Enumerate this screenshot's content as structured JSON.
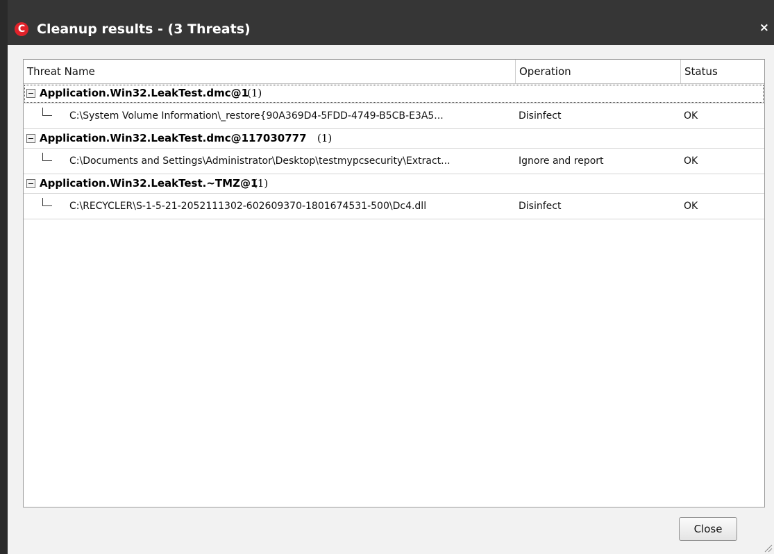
{
  "window": {
    "title": "Cleanup results - (3 Threats)",
    "close_glyph": "×",
    "logo_glyph": "C",
    "logo_icon": "comodo-logo-icon"
  },
  "table": {
    "headers": {
      "threat_name": "Threat Name",
      "operation": "Operation",
      "status": "Status"
    },
    "groups": [
      {
        "name": "Application.Win32.LeakTest.dmc@1",
        "count": "(1)",
        "items": [
          {
            "path": "C:\\System Volume Information\\_restore{90A369D4-5FDD-4749-B5CB-E3A5...",
            "operation": "Disinfect",
            "status": "OK"
          }
        ]
      },
      {
        "name": "Application.Win32.LeakTest.dmc@117030777",
        "count": "(1)",
        "items": [
          {
            "path": "C:\\Documents and Settings\\Administrator\\Desktop\\testmypcsecurity\\Extract...",
            "operation": "Ignore and report",
            "status": "OK"
          }
        ]
      },
      {
        "name": "Application.Win32.LeakTest.~TMZ@1",
        "count": "(1)",
        "items": [
          {
            "path": "C:\\RECYCLER\\S-1-5-21-2052111302-602609370-1801674531-500\\Dc4.dll",
            "operation": "Disinfect",
            "status": "OK"
          }
        ]
      }
    ]
  },
  "footer": {
    "close_label": "Close"
  },
  "colors": {
    "titlebar": "#363636",
    "logo_red": "#e0222a",
    "panel_border": "#9a9a9a"
  }
}
